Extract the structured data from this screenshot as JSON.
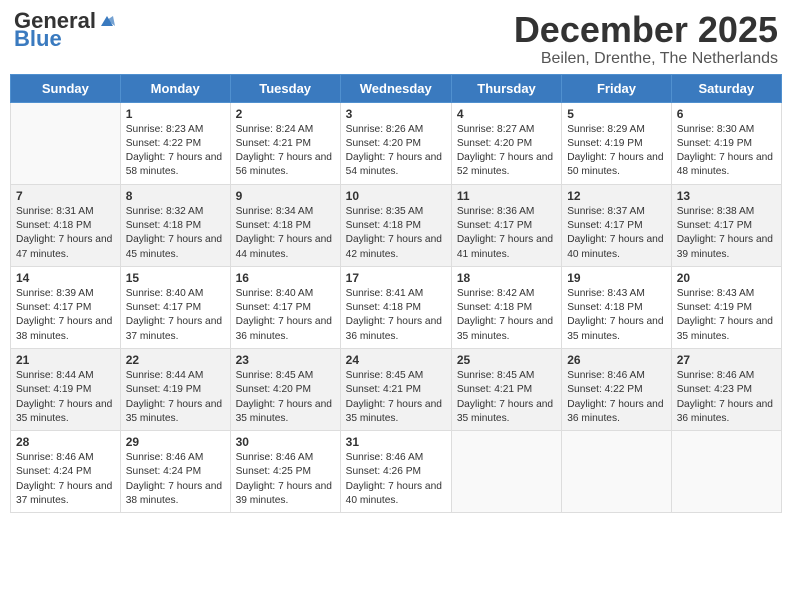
{
  "header": {
    "logo_general": "General",
    "logo_blue": "Blue",
    "month_title": "December 2025",
    "location": "Beilen, Drenthe, The Netherlands"
  },
  "weekdays": [
    "Sunday",
    "Monday",
    "Tuesday",
    "Wednesday",
    "Thursday",
    "Friday",
    "Saturday"
  ],
  "weeks": [
    [
      {
        "day": "",
        "sunrise": "",
        "sunset": "",
        "daylight": ""
      },
      {
        "day": "1",
        "sunrise": "Sunrise: 8:23 AM",
        "sunset": "Sunset: 4:22 PM",
        "daylight": "Daylight: 7 hours and 58 minutes."
      },
      {
        "day": "2",
        "sunrise": "Sunrise: 8:24 AM",
        "sunset": "Sunset: 4:21 PM",
        "daylight": "Daylight: 7 hours and 56 minutes."
      },
      {
        "day": "3",
        "sunrise": "Sunrise: 8:26 AM",
        "sunset": "Sunset: 4:20 PM",
        "daylight": "Daylight: 7 hours and 54 minutes."
      },
      {
        "day": "4",
        "sunrise": "Sunrise: 8:27 AM",
        "sunset": "Sunset: 4:20 PM",
        "daylight": "Daylight: 7 hours and 52 minutes."
      },
      {
        "day": "5",
        "sunrise": "Sunrise: 8:29 AM",
        "sunset": "Sunset: 4:19 PM",
        "daylight": "Daylight: 7 hours and 50 minutes."
      },
      {
        "day": "6",
        "sunrise": "Sunrise: 8:30 AM",
        "sunset": "Sunset: 4:19 PM",
        "daylight": "Daylight: 7 hours and 48 minutes."
      }
    ],
    [
      {
        "day": "7",
        "sunrise": "Sunrise: 8:31 AM",
        "sunset": "Sunset: 4:18 PM",
        "daylight": "Daylight: 7 hours and 47 minutes."
      },
      {
        "day": "8",
        "sunrise": "Sunrise: 8:32 AM",
        "sunset": "Sunset: 4:18 PM",
        "daylight": "Daylight: 7 hours and 45 minutes."
      },
      {
        "day": "9",
        "sunrise": "Sunrise: 8:34 AM",
        "sunset": "Sunset: 4:18 PM",
        "daylight": "Daylight: 7 hours and 44 minutes."
      },
      {
        "day": "10",
        "sunrise": "Sunrise: 8:35 AM",
        "sunset": "Sunset: 4:18 PM",
        "daylight": "Daylight: 7 hours and 42 minutes."
      },
      {
        "day": "11",
        "sunrise": "Sunrise: 8:36 AM",
        "sunset": "Sunset: 4:17 PM",
        "daylight": "Daylight: 7 hours and 41 minutes."
      },
      {
        "day": "12",
        "sunrise": "Sunrise: 8:37 AM",
        "sunset": "Sunset: 4:17 PM",
        "daylight": "Daylight: 7 hours and 40 minutes."
      },
      {
        "day": "13",
        "sunrise": "Sunrise: 8:38 AM",
        "sunset": "Sunset: 4:17 PM",
        "daylight": "Daylight: 7 hours and 39 minutes."
      }
    ],
    [
      {
        "day": "14",
        "sunrise": "Sunrise: 8:39 AM",
        "sunset": "Sunset: 4:17 PM",
        "daylight": "Daylight: 7 hours and 38 minutes."
      },
      {
        "day": "15",
        "sunrise": "Sunrise: 8:40 AM",
        "sunset": "Sunset: 4:17 PM",
        "daylight": "Daylight: 7 hours and 37 minutes."
      },
      {
        "day": "16",
        "sunrise": "Sunrise: 8:40 AM",
        "sunset": "Sunset: 4:17 PM",
        "daylight": "Daylight: 7 hours and 36 minutes."
      },
      {
        "day": "17",
        "sunrise": "Sunrise: 8:41 AM",
        "sunset": "Sunset: 4:18 PM",
        "daylight": "Daylight: 7 hours and 36 minutes."
      },
      {
        "day": "18",
        "sunrise": "Sunrise: 8:42 AM",
        "sunset": "Sunset: 4:18 PM",
        "daylight": "Daylight: 7 hours and 35 minutes."
      },
      {
        "day": "19",
        "sunrise": "Sunrise: 8:43 AM",
        "sunset": "Sunset: 4:18 PM",
        "daylight": "Daylight: 7 hours and 35 minutes."
      },
      {
        "day": "20",
        "sunrise": "Sunrise: 8:43 AM",
        "sunset": "Sunset: 4:19 PM",
        "daylight": "Daylight: 7 hours and 35 minutes."
      }
    ],
    [
      {
        "day": "21",
        "sunrise": "Sunrise: 8:44 AM",
        "sunset": "Sunset: 4:19 PM",
        "daylight": "Daylight: 7 hours and 35 minutes."
      },
      {
        "day": "22",
        "sunrise": "Sunrise: 8:44 AM",
        "sunset": "Sunset: 4:19 PM",
        "daylight": "Daylight: 7 hours and 35 minutes."
      },
      {
        "day": "23",
        "sunrise": "Sunrise: 8:45 AM",
        "sunset": "Sunset: 4:20 PM",
        "daylight": "Daylight: 7 hours and 35 minutes."
      },
      {
        "day": "24",
        "sunrise": "Sunrise: 8:45 AM",
        "sunset": "Sunset: 4:21 PM",
        "daylight": "Daylight: 7 hours and 35 minutes."
      },
      {
        "day": "25",
        "sunrise": "Sunrise: 8:45 AM",
        "sunset": "Sunset: 4:21 PM",
        "daylight": "Daylight: 7 hours and 35 minutes."
      },
      {
        "day": "26",
        "sunrise": "Sunrise: 8:46 AM",
        "sunset": "Sunset: 4:22 PM",
        "daylight": "Daylight: 7 hours and 36 minutes."
      },
      {
        "day": "27",
        "sunrise": "Sunrise: 8:46 AM",
        "sunset": "Sunset: 4:23 PM",
        "daylight": "Daylight: 7 hours and 36 minutes."
      }
    ],
    [
      {
        "day": "28",
        "sunrise": "Sunrise: 8:46 AM",
        "sunset": "Sunset: 4:24 PM",
        "daylight": "Daylight: 7 hours and 37 minutes."
      },
      {
        "day": "29",
        "sunrise": "Sunrise: 8:46 AM",
        "sunset": "Sunset: 4:24 PM",
        "daylight": "Daylight: 7 hours and 38 minutes."
      },
      {
        "day": "30",
        "sunrise": "Sunrise: 8:46 AM",
        "sunset": "Sunset: 4:25 PM",
        "daylight": "Daylight: 7 hours and 39 minutes."
      },
      {
        "day": "31",
        "sunrise": "Sunrise: 8:46 AM",
        "sunset": "Sunset: 4:26 PM",
        "daylight": "Daylight: 7 hours and 40 minutes."
      },
      {
        "day": "",
        "sunrise": "",
        "sunset": "",
        "daylight": ""
      },
      {
        "day": "",
        "sunrise": "",
        "sunset": "",
        "daylight": ""
      },
      {
        "day": "",
        "sunrise": "",
        "sunset": "",
        "daylight": ""
      }
    ]
  ]
}
